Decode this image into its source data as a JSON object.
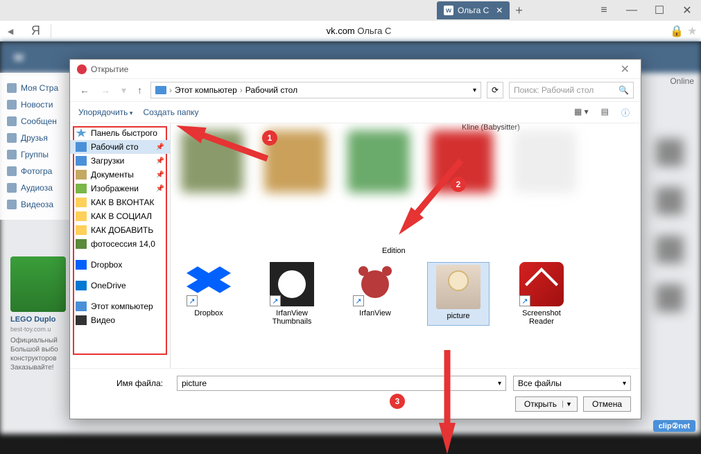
{
  "browser": {
    "tab_title": "Ольга С",
    "url_domain": "vk.com",
    "url_rest": " Ольга С",
    "new_tab": "+"
  },
  "vk": {
    "sidebar": [
      "Моя Стра",
      "Новости",
      "Сообщен",
      "Друзья",
      "Группы",
      "Фотогра",
      "Аудиоза",
      "Видеоза"
    ],
    "lego_title": "LEGO Duplo",
    "lego_sub": "best-toy.com.u",
    "lego_text": "Официальный Большой выбо конструкторов Заказывайте!",
    "online": "Online"
  },
  "dialog": {
    "title": "Открытие",
    "breadcrumb": [
      "Этот компьютер",
      "Рабочий стол"
    ],
    "search_placeholder": "Поиск: Рабочий стол",
    "toolbar": {
      "organize": "Упорядочить",
      "new_folder": "Создать папку"
    },
    "tree": [
      {
        "label": "Панель быстрого",
        "icon": "star",
        "pin": false
      },
      {
        "label": "Рабочий сто",
        "icon": "desktop",
        "pin": true,
        "selected": true
      },
      {
        "label": "Загрузки",
        "icon": "download",
        "pin": true
      },
      {
        "label": "Документы",
        "icon": "docs",
        "pin": true
      },
      {
        "label": "Изображени",
        "icon": "images",
        "pin": true
      },
      {
        "label": "КАК В ВКОНТАК",
        "icon": "folder",
        "pin": false
      },
      {
        "label": "КАК В СОЦИАЛ",
        "icon": "folder",
        "pin": false
      },
      {
        "label": "КАК ДОБАВИТЬ",
        "icon": "folder",
        "pin": false
      },
      {
        "label": "фотосессия 14,0",
        "icon": "camera",
        "pin": false
      },
      {
        "label": "Dropbox",
        "icon": "dropbox",
        "group": true
      },
      {
        "label": "OneDrive",
        "icon": "onedrive",
        "group": true
      },
      {
        "label": "Этот компьютер",
        "icon": "pc",
        "group": true
      },
      {
        "label": "Видео",
        "icon": "video",
        "pin": false
      }
    ],
    "top_label": "Kline (Babysitter)",
    "edition_label": "Edition",
    "files": [
      {
        "name": "Dropbox",
        "thumb": "dropbox",
        "shortcut": true
      },
      {
        "name": "IrfanView Thumbnails",
        "thumb": "irfan",
        "shortcut": true
      },
      {
        "name": "IrfanView",
        "thumb": "irfan2",
        "shortcut": true
      },
      {
        "name": "picture",
        "thumb": "pic",
        "selected": true
      },
      {
        "name": "Screenshot Reader",
        "thumb": "reader",
        "shortcut": true
      }
    ],
    "filename_label": "Имя файла:",
    "filename_value": "picture",
    "filter": "Все файлы",
    "open_btn": "Открыть",
    "cancel_btn": "Отмена"
  },
  "annotations": {
    "n1": "1",
    "n2": "2",
    "n3": "3"
  },
  "watermark": "clip②net"
}
